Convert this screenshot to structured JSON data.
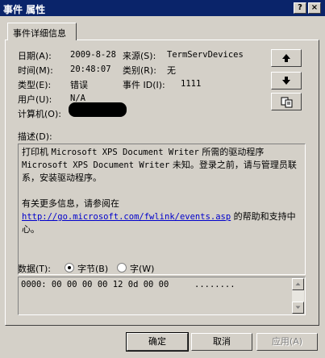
{
  "window": {
    "title": "事件 属性"
  },
  "titlebar_buttons": {
    "help": "?",
    "close": "×"
  },
  "tab": {
    "label": "事件详细信息"
  },
  "fields": {
    "date_label": "日期(A):",
    "date_value": "2009-8-28",
    "source_label": "来源(S):",
    "source_value": "TermServDevices",
    "time_label": "时间(M):",
    "time_value": "20:48:07",
    "category_label": "类别(R):",
    "category_value": "无",
    "type_label": "类型(E):",
    "type_value": "错误",
    "eventid_label": "事件 ID(I):",
    "eventid_value": "1111",
    "user_label": "用户(U):",
    "user_value": "N/A",
    "computer_label": "计算机(O):"
  },
  "description": {
    "label": "描述(D):",
    "line1_a": "打印机 ",
    "line1_mono": "Microsoft XPS Document Writer",
    "line1_b": " 所需的驱动程序",
    "line2_mono": "Microsoft XPS Document Writer",
    "line2_b": " 未知。登录之前，请与管理员联系，安装驱动程序。",
    "more_info": "有关更多信息，请参阅在",
    "link": "http://go.microsoft.com/fwlink/events.asp",
    "link_suffix": " 的帮助和支持中心。"
  },
  "data": {
    "label": "数据(T):",
    "bytes_option": "字节(B)",
    "words_option": "字(W)",
    "selected": "bytes",
    "hex_line": "0000: 00 00 00 00 12 0d 00 00",
    "ascii": "........"
  },
  "buttons": {
    "ok": "确定",
    "cancel": "取消",
    "apply": "应用(A)"
  }
}
